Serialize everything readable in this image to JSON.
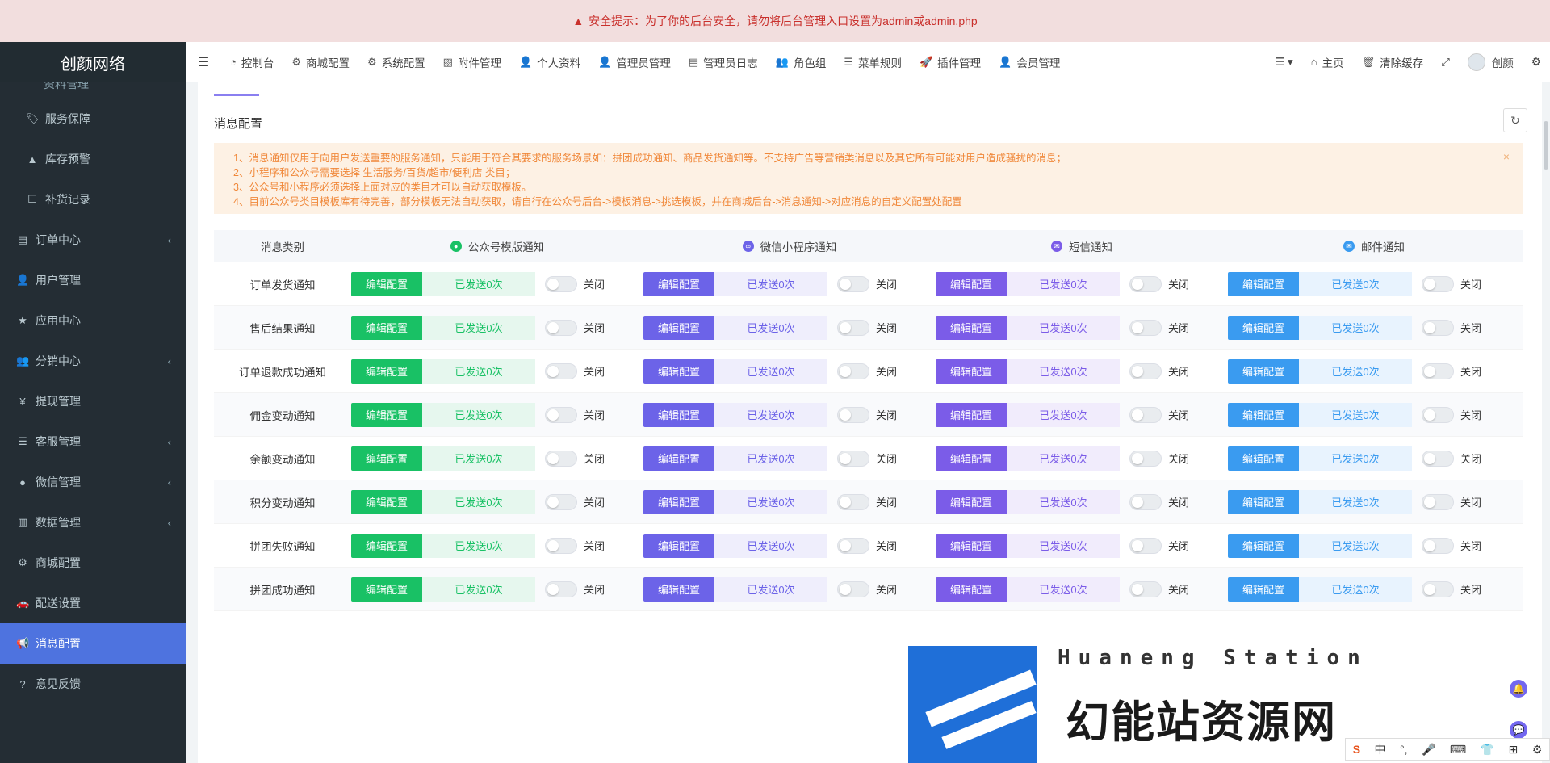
{
  "security_alert": {
    "icon": "warning-icon",
    "text": "安全提示：为了你的后台安全，请勿将后台管理入口设置为admin或admin.php"
  },
  "brand": "创颜网络",
  "sidebar": {
    "cut_item": "资料管理",
    "items": [
      {
        "label": "服务保障",
        "icon": "tag-icon",
        "sub": true,
        "arrow": false,
        "active": false
      },
      {
        "label": "库存预警",
        "icon": "warning-icon",
        "sub": true,
        "arrow": false,
        "active": false
      },
      {
        "label": "补货记录",
        "icon": "square-icon",
        "sub": true,
        "arrow": false,
        "active": false
      },
      {
        "label": "订单中心",
        "icon": "file-icon",
        "sub": false,
        "arrow": true,
        "active": false
      },
      {
        "label": "用户管理",
        "icon": "user-icon",
        "sub": false,
        "arrow": false,
        "active": false
      },
      {
        "label": "应用中心",
        "icon": "star-icon",
        "sub": false,
        "arrow": false,
        "active": false
      },
      {
        "label": "分销中心",
        "icon": "users-icon",
        "sub": false,
        "arrow": true,
        "active": false
      },
      {
        "label": "提现管理",
        "icon": "yen-icon",
        "sub": false,
        "arrow": false,
        "active": false
      },
      {
        "label": "客服管理",
        "icon": "list-icon",
        "sub": false,
        "arrow": true,
        "active": false
      },
      {
        "label": "微信管理",
        "icon": "wechat-icon",
        "sub": false,
        "arrow": true,
        "active": false
      },
      {
        "label": "数据管理",
        "icon": "bar-chart-icon",
        "sub": false,
        "arrow": true,
        "active": false
      },
      {
        "label": "商城配置",
        "icon": "cogs-icon",
        "sub": false,
        "arrow": false,
        "active": false
      },
      {
        "label": "配送设置",
        "icon": "car-icon",
        "sub": false,
        "arrow": false,
        "active": false
      },
      {
        "label": "消息配置",
        "icon": "bullhorn-icon",
        "sub": false,
        "arrow": false,
        "active": true
      },
      {
        "label": "意见反馈",
        "icon": "question-icon",
        "sub": false,
        "arrow": false,
        "active": false
      }
    ]
  },
  "topnav": {
    "items": [
      {
        "label": "控制台",
        "icon": "dashboard-icon"
      },
      {
        "label": "商城配置",
        "icon": "cogs-icon"
      },
      {
        "label": "系统配置",
        "icon": "gear-icon"
      },
      {
        "label": "附件管理",
        "icon": "file-image-icon"
      },
      {
        "label": "个人资料",
        "icon": "user-icon"
      },
      {
        "label": "管理员管理",
        "icon": "user-icon"
      },
      {
        "label": "管理员日志",
        "icon": "list-alt-icon"
      },
      {
        "label": "角色组",
        "icon": "group-icon"
      },
      {
        "label": "菜单规则",
        "icon": "bars-icon"
      },
      {
        "label": "插件管理",
        "icon": "rocket-icon"
      },
      {
        "label": "会员管理",
        "icon": "user-icon"
      }
    ],
    "right": {
      "home": "主页",
      "clear_cache": "清除缓存",
      "username": "创颜"
    }
  },
  "page": {
    "title": "消息配置",
    "notice": [
      "1、消息通知仅用于向用户发送重要的服务通知，只能用于符合其要求的服务场景如：拼团成功通知、商品发货通知等。不支持广告等营销类消息以及其它所有可能对用户造成骚扰的消息；",
      "2、小程序和公众号需要选择 生活服务/百货/超市/便利店 类目；",
      "3、公众号和小程序必须选择上面对应的类目才可以自动获取模板。",
      "4、目前公众号类目模板库有待完善，部分模板无法自动获取，请自行在公众号后台->模板消息->挑选模板，并在商城后台->消息通知->对应消息的自定义配置处配置"
    ]
  },
  "table": {
    "header_type": "消息类别",
    "channels": [
      {
        "name": "公众号模版通知",
        "theme": "ch-green",
        "icon": "wechat-icon",
        "color": "#19c165"
      },
      {
        "name": "微信小程序通知",
        "theme": "ch-purple",
        "icon": "mini-program-icon",
        "color": "#6c63e8"
      },
      {
        "name": "短信通知",
        "theme": "ch-violet",
        "icon": "sms-icon",
        "color": "#7b5ce8"
      },
      {
        "name": "邮件通知",
        "theme": "ch-blue",
        "icon": "mail-icon",
        "color": "#3a9bf0"
      }
    ],
    "edit_label": "编辑配置",
    "sent_label": "已发送0次",
    "toggle_label": "关闭",
    "rows": [
      "订单发货通知",
      "售后结果通知",
      "订单退款成功通知",
      "佣金变动通知",
      "余额变动通知",
      "积分变动通知",
      "拼团失败通知",
      "拼团成功通知"
    ]
  },
  "watermark": {
    "en": "Huaneng Station",
    "cn": "幻能站资源网"
  },
  "ime": [
    "中",
    "°,",
    "🎤",
    "⌨",
    "👕",
    "⊞",
    "⚙"
  ]
}
